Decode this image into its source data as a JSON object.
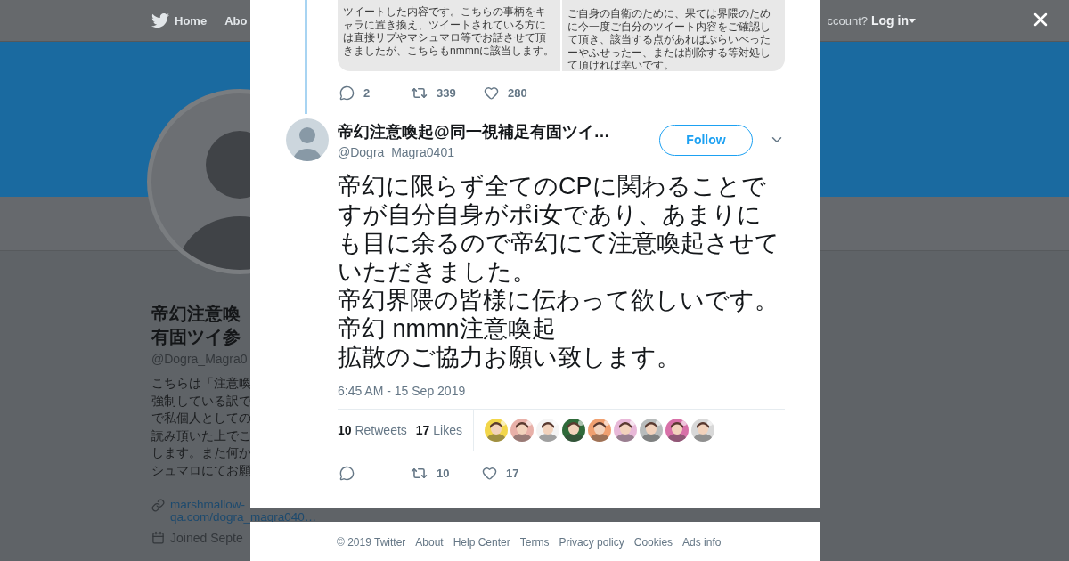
{
  "nav": {
    "items": [
      {
        "label": "Home",
        "selected": false
      },
      {
        "label": "Abo",
        "selected": false
      }
    ],
    "account_prompt": "ccount?",
    "login": "Log in"
  },
  "profile": {
    "name_lines": [
      "帝幻注意喚",
      "有固ツイ参"
    ],
    "handle": "@Dogra_Magra0",
    "bio_lines": [
      "こちらは「注意喚",
      "強制している訳で",
      "で私個人としての",
      "読み頂いた上でこ",
      "します。また何か",
      "シュマロにてお願"
    ],
    "link_lines": [
      "marshmallow-",
      "qa.com/dogra_magra040…"
    ],
    "joined": "Joined Septe"
  },
  "modal": {
    "parent_tweet": {
      "image_panels": [
        {
          "text": "ツイートした内容です。こちらの事柄をキャラに置き換え、ツイートされている方には直接リプやマシュマロ等でお話させて頂きましたが、こちらもnmmnに該当します。"
        },
        {
          "text": "ご自身の自衛のために、果ては界隈のために今一度ご自分のツイート内容をご確認して頂き、該当する点があればぷらいべったーやふせったー、または削除する等対処して頂ければ幸いです。"
        }
      ],
      "replies": "2",
      "retweets": "339",
      "likes": "280"
    },
    "tweet": {
      "name": "帝幻注意喚起@同一視補足有固ツイ…",
      "handle": "@Dogra_Magra0401",
      "follow": "Follow",
      "paragraphs": [
        "帝幻に限らず全てのCPに関わることですが自分自身がポi女であり、あまりにも目に余るので帝幻にて注意喚起させていただきました。",
        "帝幻界隈の皆様に伝わって欲しいです。",
        "帝幻 nmmn注意喚起",
        "拡散のご協力お願い致します。"
      ],
      "timestamp": "6:45 AM - 15 Sep 2019",
      "stats": [
        {
          "count": "10",
          "label": "Retweets"
        },
        {
          "count": "17",
          "label": "Likes"
        }
      ],
      "retweets": "10",
      "likes": "17"
    }
  },
  "footer": [
    "© 2019 Twitter",
    "About",
    "Help Center",
    "Terms",
    "Privacy policy",
    "Cookies",
    "Ads info"
  ]
}
